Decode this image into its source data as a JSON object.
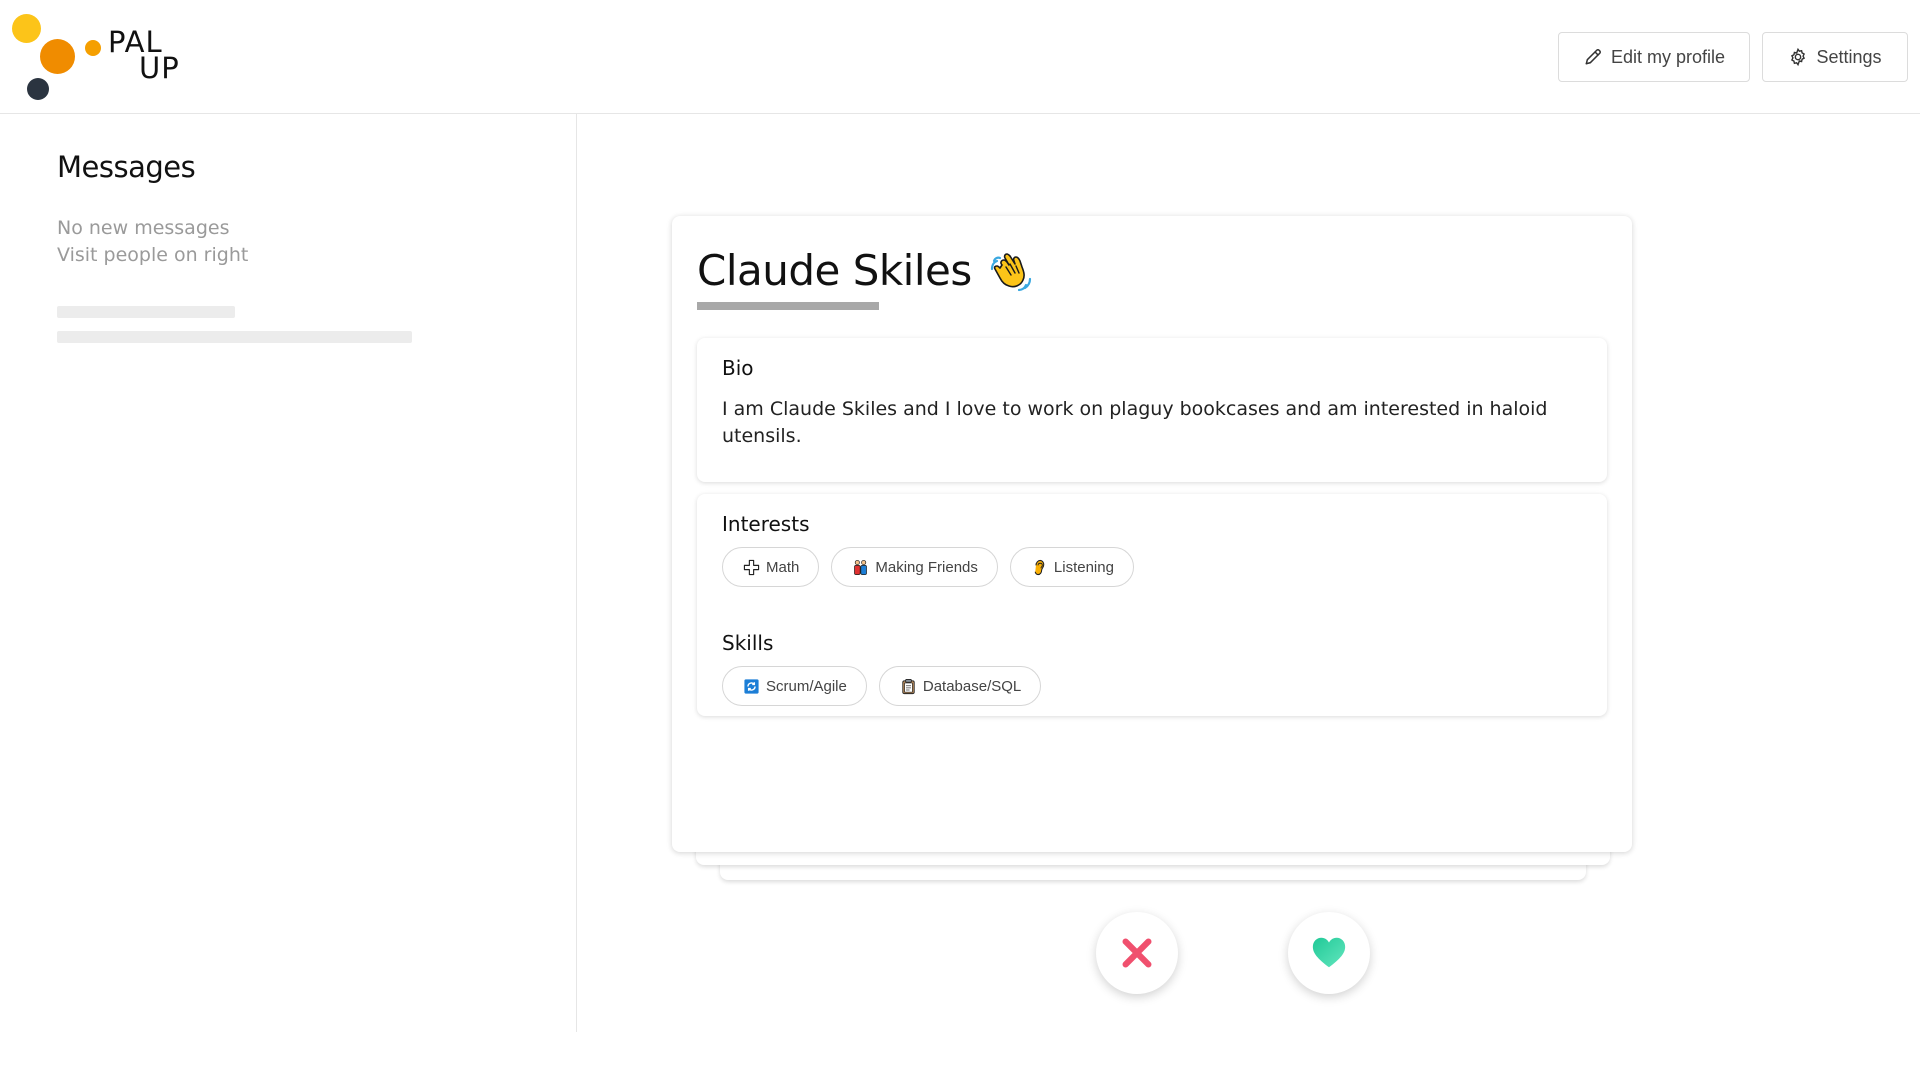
{
  "app": {
    "logo_line1": "PAL",
    "logo_line2": "UP"
  },
  "header": {
    "edit_profile_label": "Edit my profile",
    "settings_label": "Settings"
  },
  "sidebar": {
    "title": "Messages",
    "empty_line1": "No new messages",
    "empty_line2": "Visit people on right"
  },
  "profile": {
    "name": "Claude Skiles",
    "name_emoji": "waving-hand-icon",
    "bio_heading": "Bio",
    "bio": "I am Claude Skiles and I love to work on plaguy bookcases and am interested in haloid utensils.",
    "interests_heading": "Interests",
    "interests": [
      {
        "label": "Math",
        "icon": "plus-icon"
      },
      {
        "label": "Making Friends",
        "icon": "people-icon"
      },
      {
        "label": "Listening",
        "icon": "ear-icon"
      }
    ],
    "skills_heading": "Skills",
    "skills": [
      {
        "label": "Scrum/Agile",
        "icon": "cycle-icon"
      },
      {
        "label": "Database/SQL",
        "icon": "clipboard-icon"
      }
    ]
  },
  "actions": {
    "reject": "reject-x-icon",
    "like": "heart-icon"
  },
  "colors": {
    "logo_yellow": "#fcc419",
    "logo_orange": "#f08c00",
    "logo_dark": "#2b3440",
    "reject": "#f0506e",
    "like": "#38d9a9"
  }
}
